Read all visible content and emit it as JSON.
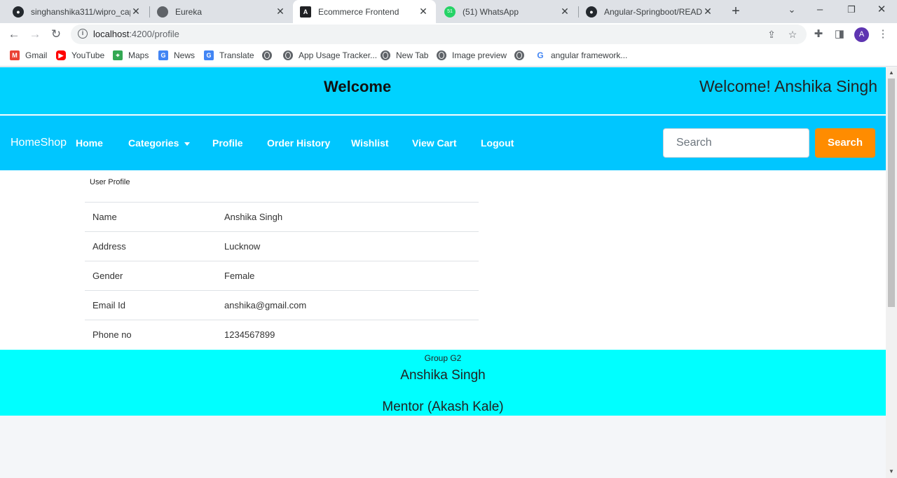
{
  "browser": {
    "tabs": [
      {
        "title": "singhanshika311/wipro_caps",
        "icon": "github-icon",
        "active": false
      },
      {
        "title": "Eureka",
        "icon": "globe-icon",
        "active": false
      },
      {
        "title": "Ecommerce Frontend",
        "icon": "angular-icon",
        "active": true
      },
      {
        "title": "(51) WhatsApp",
        "icon": "whatsapp-icon",
        "badge": "51",
        "active": false
      },
      {
        "title": "Angular-Springboot/READM",
        "icon": "github-icon",
        "active": false
      }
    ],
    "url_host": "localhost",
    "url_path": ":4200/profile",
    "avatar_letter": "A",
    "bookmarks": [
      {
        "label": "Gmail",
        "icon": "gmail-icon"
      },
      {
        "label": "YouTube",
        "icon": "youtube-icon"
      },
      {
        "label": "Maps",
        "icon": "maps-icon"
      },
      {
        "label": "News",
        "icon": "news-icon"
      },
      {
        "label": "Translate",
        "icon": "translate-icon"
      },
      {
        "label": "",
        "icon": "globe-icon"
      },
      {
        "label": "App Usage Tracker...",
        "icon": "globe-icon"
      },
      {
        "label": "New Tab",
        "icon": "globe-icon"
      },
      {
        "label": "Image preview",
        "icon": "globe-icon"
      },
      {
        "label": "",
        "icon": "globe-icon"
      },
      {
        "label": "angular framework...",
        "icon": "google-icon"
      }
    ]
  },
  "header": {
    "title": "Welcome",
    "greeting": "Welcome! Anshika Singh"
  },
  "navbar": {
    "brand": "HomeShop",
    "links": [
      "Home",
      "Categories",
      "Profile",
      "Order History",
      "Wishlist",
      "View Cart",
      "Logout"
    ],
    "search_placeholder": "Search",
    "search_button": "Search"
  },
  "profile": {
    "heading": "User Profile",
    "rows": [
      {
        "label": "Name",
        "value": "Anshika Singh"
      },
      {
        "label": "Address",
        "value": "Lucknow"
      },
      {
        "label": "Gender",
        "value": "Female"
      },
      {
        "label": "Email Id",
        "value": "anshika@gmail.com"
      },
      {
        "label": "Phone no",
        "value": "1234567899"
      }
    ]
  },
  "footer": {
    "group": "Group G2",
    "name": "Anshika Singh",
    "mentor": "Mentor (Akash Kale)"
  },
  "colors": {
    "header_bg": "#00d2ff",
    "navbar_bg": "#00c6ff",
    "search_button_bg": "#ff8c00",
    "footer_bg": "#00ffff"
  }
}
